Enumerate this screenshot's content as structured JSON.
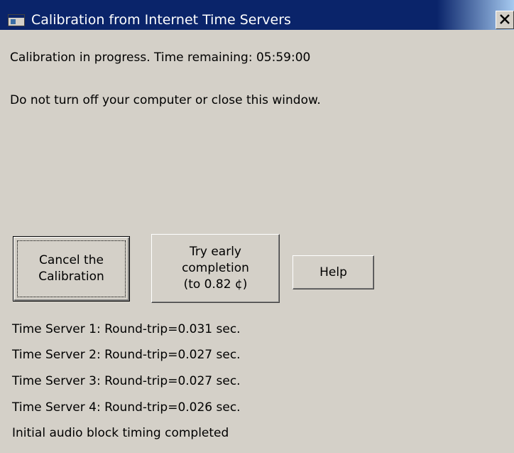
{
  "window": {
    "title": "Calibration from Internet Time Servers"
  },
  "message": {
    "progress": "Calibration in progress. Time remaining: 05:59:00",
    "warning": "Do not turn off your computer or close this window."
  },
  "buttons": {
    "cancel": "Cancel the\nCalibration",
    "early": "Try early\ncompletion\n(to 0.82 ¢)",
    "help": "Help"
  },
  "status_lines": [
    "Time Server 1: Round-trip=0.031 sec.",
    "Time Server 2: Round-trip=0.027 sec.",
    "Time Server 3: Round-trip=0.027 sec.",
    "Time Server 4: Round-trip=0.026 sec.",
    "Initial audio block timing completed"
  ],
  "colors": {
    "titlebar": "#0a246a",
    "face": "#d4d0c8"
  }
}
